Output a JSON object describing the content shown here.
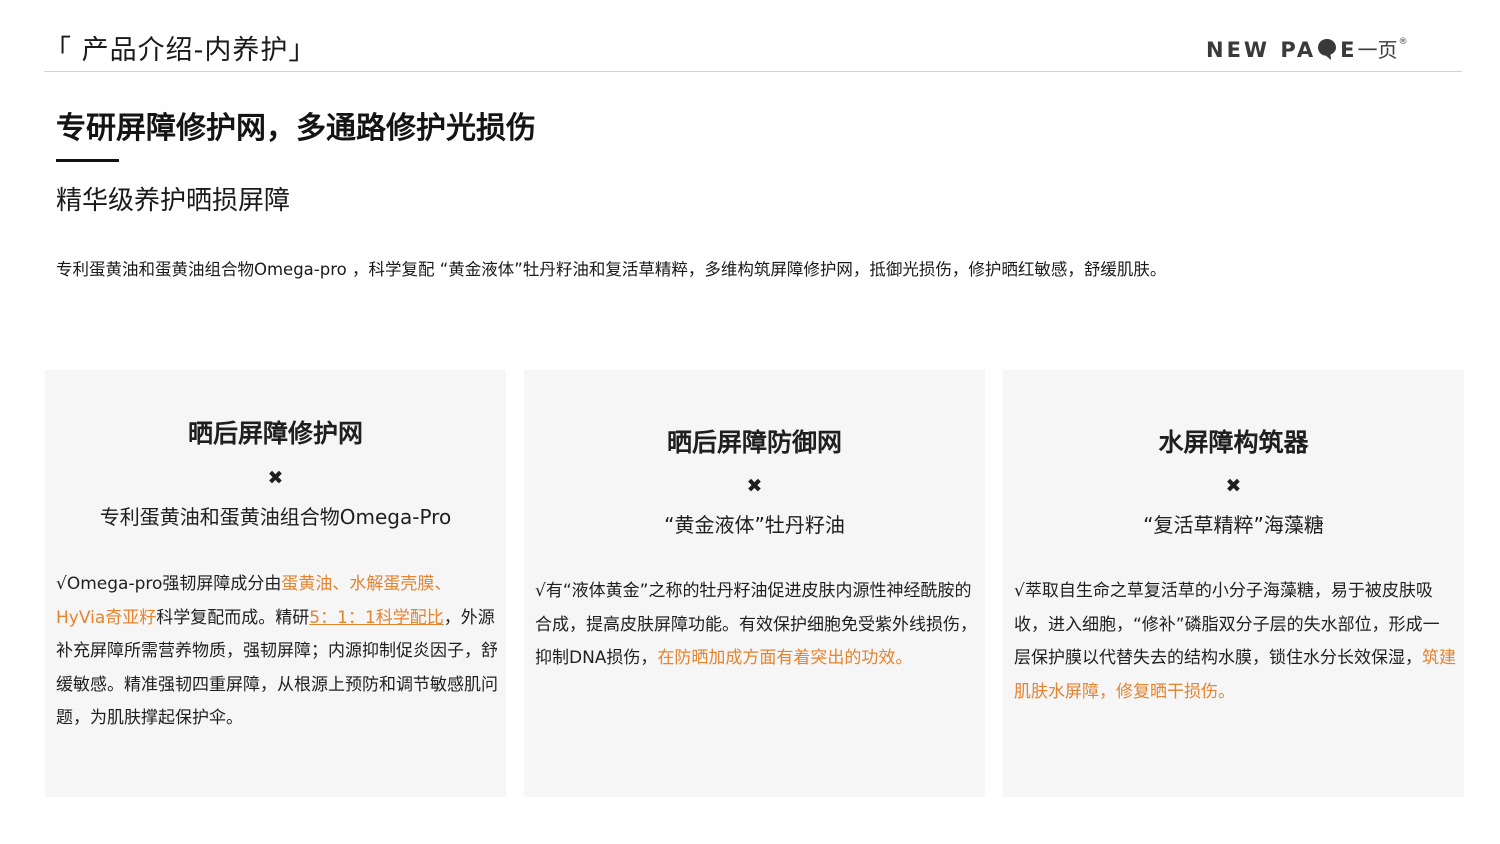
{
  "header": {
    "section_title": "「 产品介绍-内养护」",
    "brand": {
      "text": "NEW PA",
      "text2": "E",
      "cn": "一页",
      "reg": "®"
    }
  },
  "headline": "专研屏障修护网，多通路修护光损伤",
  "subheadline": "精华级养护晒损屏障",
  "intro": "专利蛋黄油和蛋黄油组合物Omega-pro ，科学复配 “黄金液体”牡丹籽油和复活草精粹，多维构筑屏障修护网，抵御光损伤，修护晒红敏感，舒缓肌肤。",
  "colors": {
    "accent": "#e5832e",
    "card_bg": "#f6f6f6"
  },
  "cards": [
    {
      "title": "晒后屏障修护网",
      "cross": "✖",
      "subtitle": "专利蛋黄油和蛋黄油组合物Omega-Pro",
      "body": {
        "p1": "√Omega-pro强韧屏障成分由",
        "h1": "蛋黄油、水解蛋壳膜、HyVia奇亚籽",
        "p2": "科学复配而成。精研",
        "h2": "5：1：1科学配比",
        "p3": "，外源补充屏障所需营养物质，强韧屏障；内源抑制促炎因子，舒缓敏感。精准强韧四重屏障，从根源上预防和调节敏感肌问题，为肌肤撑起保护伞。"
      }
    },
    {
      "title": "晒后屏障防御网",
      "cross": "✖",
      "subtitle": "“黄金液体”牡丹籽油",
      "body": {
        "p1": "√有“液体黄金”之称的牡丹籽油促进皮肤内源性神经酰胺的合成，提高皮肤屏障功能。有效保护细胞免受紫外线损伤，抑制DNA损伤，",
        "h1": "在防晒加成方面有着突出的功效。"
      }
    },
    {
      "title": "水屏障构筑器",
      "cross": "✖",
      "subtitle": "“复活草精粹”海藻糖",
      "body": {
        "p1": "√萃取自生命之草复活草的小分子海藻糖，易于被皮肤吸收，进入细胞，“修补”磷脂双分子层的失水部位，形成一层保护膜以代替失去的结构水膜，锁住水分长效保湿，",
        "h1": "筑建肌肤水屏障，修复晒干损伤。"
      }
    }
  ]
}
